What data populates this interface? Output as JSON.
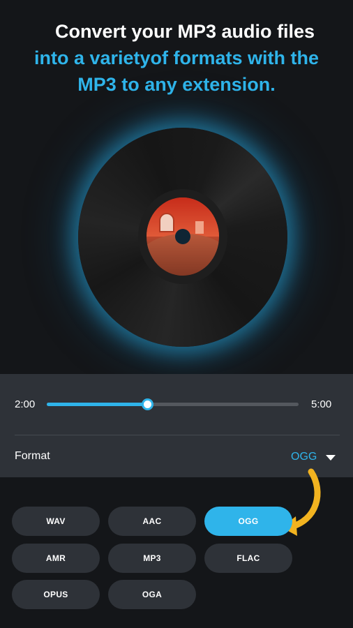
{
  "headline": {
    "line1": "Convert your MP3 audio files",
    "line2": "into a varietyof formats with the",
    "line3": "MP3 to any extension."
  },
  "player": {
    "current_time": "2:00",
    "total_time": "5:00",
    "progress_fraction": 0.4
  },
  "format": {
    "label": "Format",
    "selected": "OGG",
    "options": [
      "WAV",
      "AAC",
      "OGG",
      "AMR",
      "MP3",
      "FLAC",
      "OPUS",
      "OGA"
    ]
  },
  "colors": {
    "accent": "#2fb4ea",
    "background": "#141619",
    "panel": "#2e3238",
    "arrow": "#f2b320"
  }
}
